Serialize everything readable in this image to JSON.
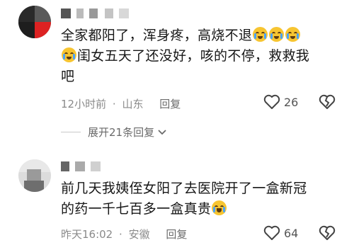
{
  "comments": [
    {
      "text_line1": "全家都阳了，浑身疼，高烧不退",
      "text_line2": "闺女五天了还没好，咳的不停，救救我",
      "text_line3": "吧",
      "time": "12小时前",
      "location": "山东",
      "reply_label": "回复",
      "likes": "26",
      "expand_label": "展开21条回复"
    },
    {
      "text_line1": "前几天我姨侄女阳了去医院开了一盒新冠",
      "text_line2": "的药一千七百多一盒真贵",
      "time": "昨天16:02",
      "location": "安徽",
      "reply_label": "回复",
      "likes": "64"
    }
  ],
  "separator": "·",
  "colors": {
    "meta_gray": "#8a8a8a",
    "emoji_yellow": "#f7c531"
  }
}
